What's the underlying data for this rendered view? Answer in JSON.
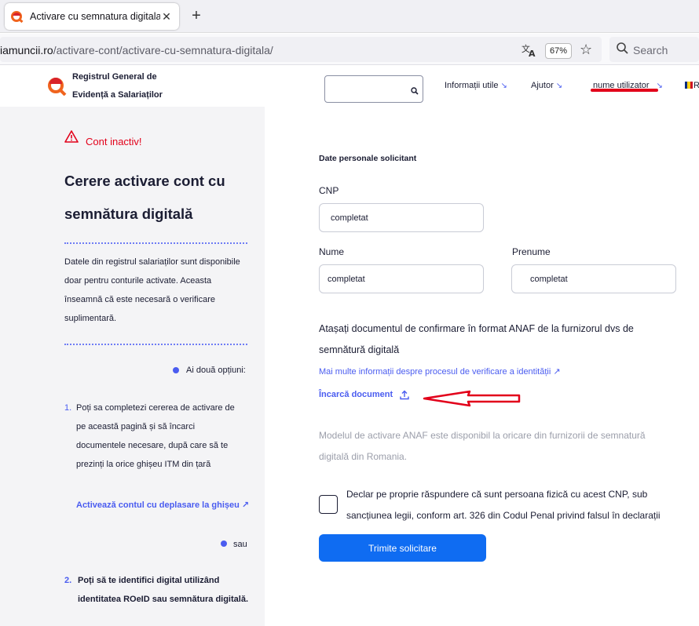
{
  "browser": {
    "tab_title": "Activare cu semnatura digitala",
    "tab_close": "✕",
    "new_tab": "+",
    "url_host": "iamuncii.ro",
    "url_path": "/activare-cont/activare-cu-semnatura-digitala/",
    "zoom": "67%",
    "search_placeholder": "Search"
  },
  "header": {
    "brand_line1": "Registrul General de",
    "brand_line2": "Evidență a Salariaților",
    "nav": [
      "Informații utile",
      "Ajutor",
      "nume utilizator"
    ],
    "nav_arrow": "↘",
    "lang_partial": "R"
  },
  "left": {
    "status": "Cont inactiv!",
    "title_line1": "Cerere activare cont cu",
    "title_line2": "semnătura digitală",
    "intro_lines": [
      "Datele din registrul salariaților sunt disponibile",
      "doar pentru conturile activate. Aceasta",
      "înseamnă că este necesară o verificare",
      "suplimentară."
    ],
    "options_label": "Ai două opțiuni:",
    "option1_num": "1.",
    "option1_lines": [
      "Poți sa completezi cererea de activare de",
      "pe această pagină și să încarci",
      "documentele necesare, după care să te",
      "prezinți la orice ghișeu ITM din țară"
    ],
    "option1_link": "Activează contul cu deplasare la ghișeu",
    "link_arrow": "↗",
    "or_label": "sau",
    "option2_num": "2.",
    "option2_lines": [
      "Poți să te identifici digital utilizând",
      "identitatea ROeID sau semnătura digitală."
    ]
  },
  "form": {
    "section_title": "Date personale solicitant",
    "cnp_label": "CNP",
    "cnp_value": "completat",
    "nume_label": "Nume",
    "nume_value": "completat",
    "prenume_label": "Prenume",
    "prenume_value": "completat",
    "attach_text": "Atașați documentul de confirmare în format ANAF de la furnizorul dvs de semnătură digitală",
    "info_link": "Mai multe informații despre procesul de verificare a identității",
    "info_arrow": "↗",
    "upload_label": "Încarcă document",
    "model_text": "Modelul de activare ANAF este disponibil la oricare din furnizorii de semnatură digitală din Romania.",
    "declaration": "Declar pe proprie răspundere că sunt persoana fizică cu acest CNP, sub sancțiunea legii, conform art. 326 din Codul Penal privind falsul în declarații",
    "submit_label": "Trimite solicitare"
  },
  "colors": {
    "accent": "#4a5cf0",
    "submit": "#0f6cf2",
    "alert": "#e2001a",
    "panel": "#f4f4f6"
  }
}
